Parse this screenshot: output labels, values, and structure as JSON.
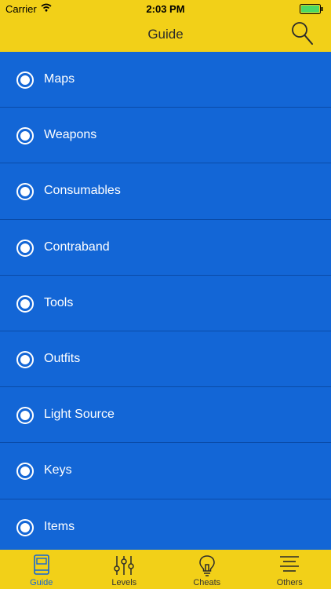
{
  "status": {
    "carrier": "Carrier",
    "time": "2:03 PM"
  },
  "header": {
    "title": "Guide"
  },
  "list": [
    {
      "label": "Maps"
    },
    {
      "label": "Weapons"
    },
    {
      "label": "Consumables"
    },
    {
      "label": "Contraband"
    },
    {
      "label": "Tools"
    },
    {
      "label": "Outfits"
    },
    {
      "label": "Light Source"
    },
    {
      "label": "Keys"
    },
    {
      "label": "Items"
    }
  ],
  "tabs": [
    {
      "label": "Guide",
      "icon": "book-icon",
      "active": true
    },
    {
      "label": "Levels",
      "icon": "sliders-icon",
      "active": false
    },
    {
      "label": "Cheats",
      "icon": "lightbulb-icon",
      "active": false
    },
    {
      "label": "Others",
      "icon": "list-icon",
      "active": false
    }
  ],
  "colors": {
    "accent": "#f2d018",
    "background": "#1366d6",
    "active_tab": "#1366d6"
  }
}
